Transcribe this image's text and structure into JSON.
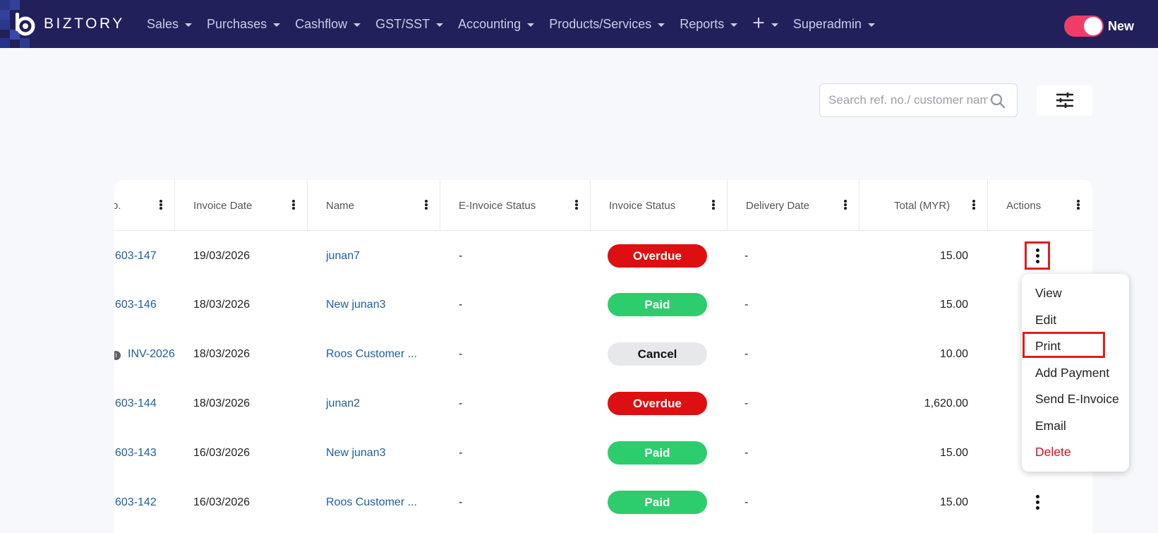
{
  "brand": {
    "name": "BIZTORY"
  },
  "nav": {
    "items": [
      {
        "label": "Sales"
      },
      {
        "label": "Purchases"
      },
      {
        "label": "Cashflow"
      },
      {
        "label": "GST/SST"
      },
      {
        "label": "Accounting"
      },
      {
        "label": "Products/Services"
      },
      {
        "label": "Reports"
      },
      {
        "label": "+"
      },
      {
        "label": "Superadmin"
      }
    ],
    "toggle_label": "New",
    "toggle_on": true
  },
  "colors": {
    "nav_bg": "#22205a",
    "toggle": "#ef3d67",
    "overdue": "#dd0f10",
    "paid": "#2dcd6e",
    "cancel": "#e6e8eb",
    "link": "#1f5fa0",
    "highlight": "#e11d1d"
  },
  "search": {
    "placeholder": "Search ref. no./ customer name",
    "value": ""
  },
  "table": {
    "columns": [
      {
        "label": "o."
      },
      {
        "label": "Invoice Date"
      },
      {
        "label": "Name"
      },
      {
        "label": "E-Invoice Status"
      },
      {
        "label": "Invoice Status"
      },
      {
        "label": "Delivery Date"
      },
      {
        "label": "Total (MYR)"
      },
      {
        "label": "Actions"
      }
    ],
    "rows": [
      {
        "ref": "603-147",
        "date": "19/03/2026",
        "name": "junan7",
        "einvoice": "-",
        "status": "Overdue",
        "delivery": "-",
        "total": "15.00"
      },
      {
        "ref": "603-146",
        "date": "18/03/2026",
        "name": "New junan3",
        "einvoice": "-",
        "status": "Paid",
        "delivery": "-",
        "total": "15.00"
      },
      {
        "ref": "INV-2026",
        "date": "18/03/2026",
        "name": "Roos Customer ...",
        "einvoice": "-",
        "status": "Cancel",
        "delivery": "-",
        "total": "10.00"
      },
      {
        "ref": "603-144",
        "date": "18/03/2026",
        "name": "junan2",
        "einvoice": "-",
        "status": "Overdue",
        "delivery": "-",
        "total": "1,620.00"
      },
      {
        "ref": "603-143",
        "date": "16/03/2026",
        "name": "New junan3",
        "einvoice": "-",
        "status": "Paid",
        "delivery": "-",
        "total": "15.00"
      },
      {
        "ref": "603-142",
        "date": "16/03/2026",
        "name": "Roos Customer ...",
        "einvoice": "-",
        "status": "Paid",
        "delivery": "-",
        "total": "15.00"
      }
    ]
  },
  "actions_menu": {
    "items": [
      {
        "label": "View"
      },
      {
        "label": "Edit"
      },
      {
        "label": "Print"
      },
      {
        "label": "Add Payment"
      },
      {
        "label": "Send E-Invoice"
      },
      {
        "label": "Email"
      },
      {
        "label": "Delete"
      }
    ]
  }
}
